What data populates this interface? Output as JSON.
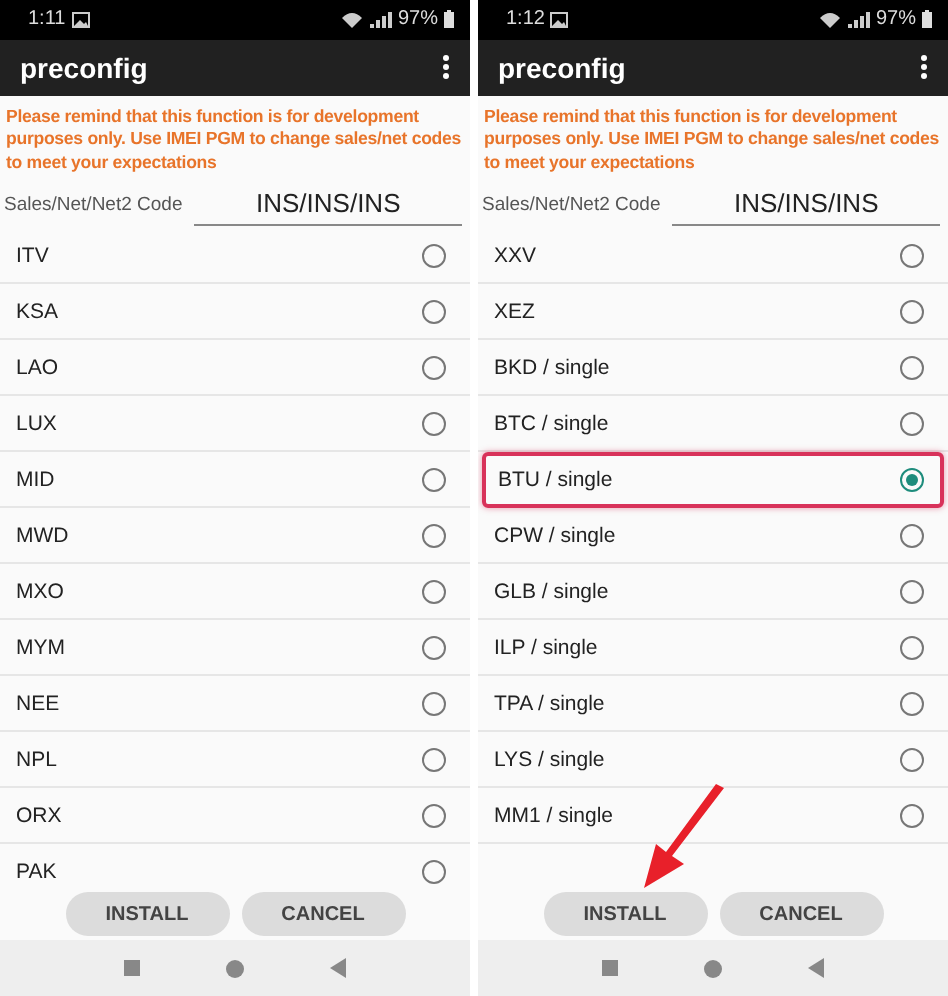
{
  "panels": [
    {
      "status_bar": {
        "time": "1:11",
        "battery": "97%"
      },
      "title": "preconfig",
      "warning": "Please remind that this function is for development purposes only. Use IMEI PGM to change sales/net codes to meet your expectations",
      "code_field": {
        "label": "Sales/Net/Net2 Code",
        "value": "INS/INS/INS"
      },
      "items": [
        {
          "label": "ITV",
          "selected": false,
          "highlighted": false
        },
        {
          "label": "KSA",
          "selected": false,
          "highlighted": false
        },
        {
          "label": "LAO",
          "selected": false,
          "highlighted": false
        },
        {
          "label": "LUX",
          "selected": false,
          "highlighted": false
        },
        {
          "label": "MID",
          "selected": false,
          "highlighted": false
        },
        {
          "label": "MWD",
          "selected": false,
          "highlighted": false
        },
        {
          "label": "MXO",
          "selected": false,
          "highlighted": false
        },
        {
          "label": "MYM",
          "selected": false,
          "highlighted": false
        },
        {
          "label": "NEE",
          "selected": false,
          "highlighted": false
        },
        {
          "label": "NPL",
          "selected": false,
          "highlighted": false
        },
        {
          "label": "ORX",
          "selected": false,
          "highlighted": false
        },
        {
          "label": "PAK",
          "selected": false,
          "highlighted": false
        }
      ],
      "buttons": [
        "INSTALL",
        "CANCEL"
      ]
    },
    {
      "status_bar": {
        "time": "1:12",
        "battery": "97%"
      },
      "title": "preconfig",
      "warning": "Please remind that this function is for development purposes only. Use IMEI PGM to change sales/net codes to meet your expectations",
      "code_field": {
        "label": "Sales/Net/Net2 Code",
        "value": "INS/INS/INS"
      },
      "items": [
        {
          "label": "XXV",
          "selected": false,
          "highlighted": false
        },
        {
          "label": "XEZ",
          "selected": false,
          "highlighted": false
        },
        {
          "label": "BKD / single",
          "selected": false,
          "highlighted": false
        },
        {
          "label": "BTC / single",
          "selected": false,
          "highlighted": false
        },
        {
          "label": "BTU / single",
          "selected": true,
          "highlighted": true
        },
        {
          "label": "CPW / single",
          "selected": false,
          "highlighted": false
        },
        {
          "label": "GLB / single",
          "selected": false,
          "highlighted": false
        },
        {
          "label": "ILP / single",
          "selected": false,
          "highlighted": false
        },
        {
          "label": "TPA / single",
          "selected": false,
          "highlighted": false
        },
        {
          "label": "LYS / single",
          "selected": false,
          "highlighted": false
        },
        {
          "label": "MM1 / single",
          "selected": false,
          "highlighted": false
        }
      ],
      "buttons": [
        "INSTALL",
        "CANCEL"
      ],
      "annotation": {
        "kind": "arrow"
      }
    }
  ]
}
